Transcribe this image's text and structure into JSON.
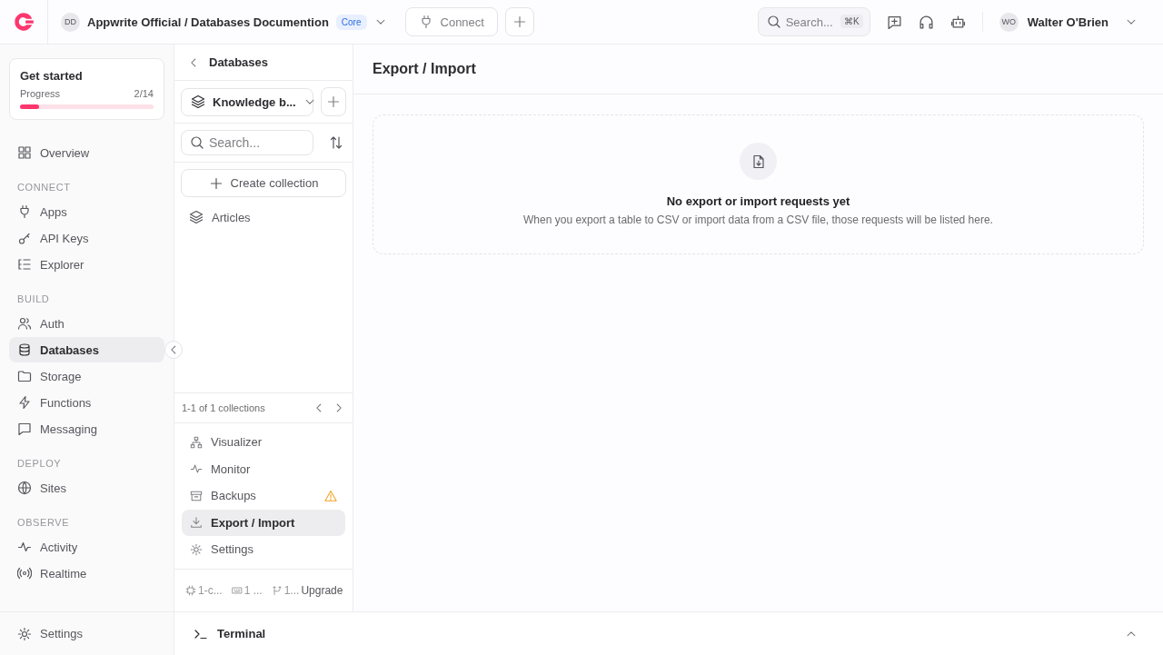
{
  "topbar": {
    "project_avatar": "DD",
    "breadcrumb": "Appwrite Official / Databases Documention",
    "plan_badge": "Core",
    "connect_button": "Connect",
    "search": {
      "placeholder": "Search...",
      "shortcut": "⌘K"
    },
    "user": {
      "avatar": "WO",
      "name": "Walter O'Brien"
    }
  },
  "sidebar": {
    "get_started": {
      "title": "Get started",
      "progress_label": "Progress",
      "progress_text": "2/14",
      "level": 0.14
    },
    "sections": [
      {
        "items": [
          {
            "label": "Overview",
            "selected": false
          }
        ]
      },
      {
        "heading": "CONNECT",
        "items": [
          {
            "label": "Apps",
            "selected": false
          },
          {
            "label": "API Keys",
            "selected": false
          },
          {
            "label": "Explorer",
            "selected": false
          }
        ]
      },
      {
        "heading": "BUILD",
        "items": [
          {
            "label": "Auth",
            "selected": false
          },
          {
            "label": "Databases",
            "selected": true
          },
          {
            "label": "Storage",
            "selected": false
          },
          {
            "label": "Functions",
            "selected": false
          },
          {
            "label": "Messaging",
            "selected": false
          }
        ]
      },
      {
        "heading": "DEPLOY",
        "items": [
          {
            "label": "Sites",
            "selected": false
          }
        ]
      },
      {
        "heading": "OBSERVE",
        "items": [
          {
            "label": "Activity",
            "selected": false
          },
          {
            "label": "Realtime",
            "selected": false
          }
        ]
      }
    ],
    "settings": "Settings"
  },
  "database_panel": {
    "title": "Databases",
    "database_select": "Knowledge b...",
    "search": {
      "placeholder": "Search..."
    },
    "create_button": "Create collection",
    "collections": [
      {
        "label": "Articles"
      }
    ],
    "pagination": "1-1 of 1 collections",
    "menu": [
      {
        "label": "Visualizer",
        "selected": false,
        "warning": false
      },
      {
        "label": "Monitor",
        "selected": false,
        "warning": false
      },
      {
        "label": "Backups",
        "selected": false,
        "warning": true
      },
      {
        "label": "Export / Import",
        "selected": true,
        "warning": false
      },
      {
        "label": "Settings",
        "selected": false,
        "warning": false
      }
    ],
    "usage": [
      "1-c...",
      "1 ...",
      "1..."
    ],
    "upgrade_link": "Upgrade"
  },
  "main": {
    "title": "Export / Import",
    "empty_state": {
      "title": "No export or import requests yet",
      "description": "When you export a table to CSV or import data from a CSV file, those requests will be listed here."
    }
  },
  "terminal": {
    "label": "Terminal"
  }
}
